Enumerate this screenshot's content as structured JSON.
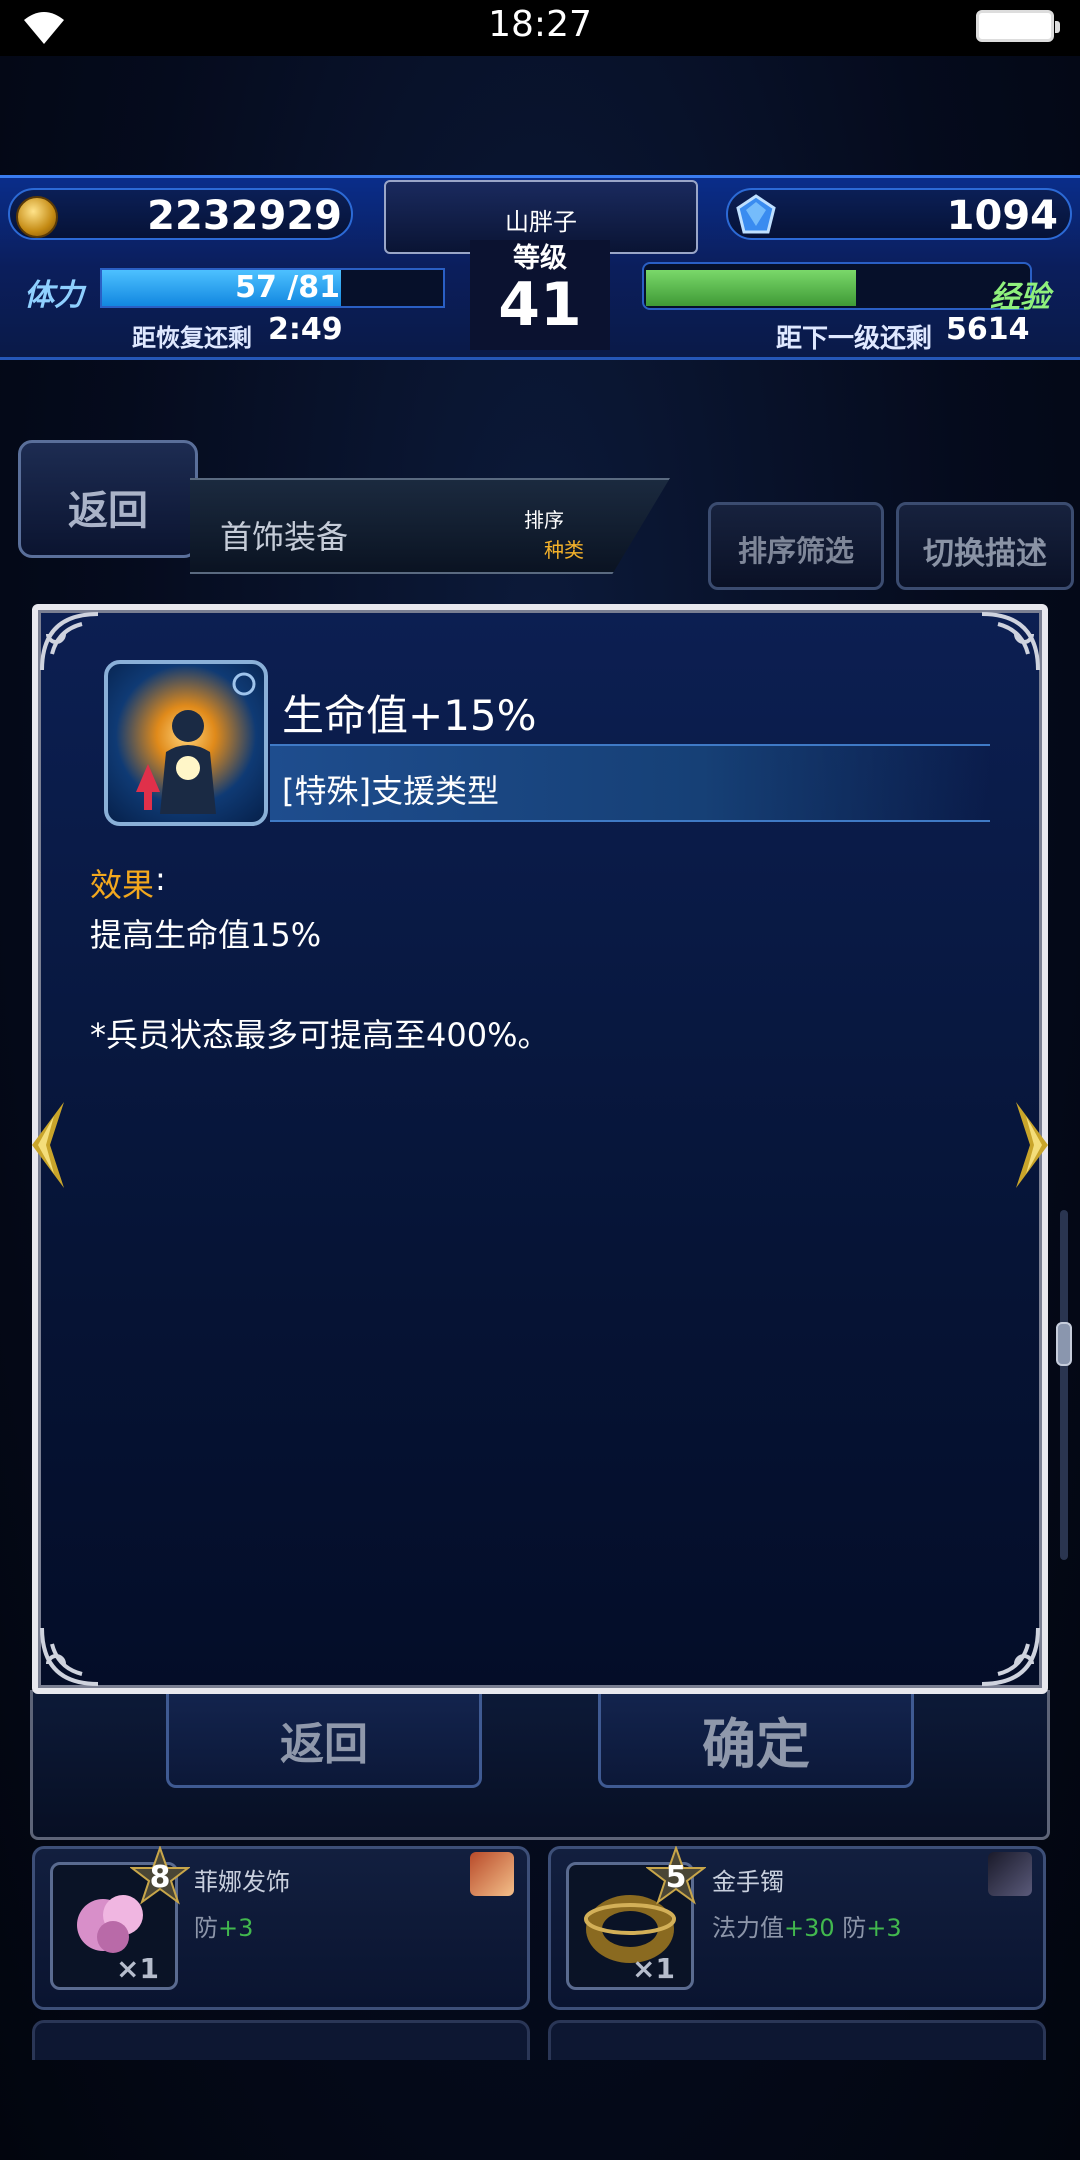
{
  "status_bar": {
    "time": "18:27",
    "wifi_icon": "wifi-icon",
    "battery_icon": "battery-icon"
  },
  "header": {
    "gil": "2232929",
    "gems": "1094",
    "stamina_label": "体力",
    "stamina_value": "57 /81",
    "stamina_fraction": 0.7,
    "recover_label": "距恢复还剩",
    "recover_time": "2:49",
    "player_name": "山胖子",
    "level_label": "等级",
    "level": "41",
    "exp_label": "经验",
    "exp_fraction": 0.55,
    "next_level_label": "距下一级还剩",
    "next_level_value": "5614"
  },
  "nav": {
    "back_label": "返回",
    "section_title": "首饰装备",
    "sort_label": "排序",
    "sort_value": "种类",
    "sort_filter_label": "排序筛选",
    "toggle_desc_label": "切换描述"
  },
  "dialog": {
    "title": "生命值+15%",
    "type": "[特殊]支援类型",
    "effect_label": "效果",
    "effect_colon": ":",
    "effect_desc": "提高生命值15%",
    "note": "*兵员状态最多可提高至400%。"
  },
  "buttons": {
    "back": "返回",
    "confirm": "确定"
  },
  "items": [
    {
      "name": "菲娜发饰",
      "stars": "8",
      "stat_label": "防",
      "stat_plus": "+3",
      "qty": "×1"
    },
    {
      "name": "金手镯",
      "stars": "5",
      "stat_label": "法力值",
      "stat_plus": "+30",
      "stat2_label": "防",
      "stat2_plus": "+3",
      "qty": "×1"
    }
  ],
  "colors": {
    "accent_orange": "#f3a81e",
    "bar_blue": "#1287e0",
    "exp_green": "#3f9a36"
  }
}
